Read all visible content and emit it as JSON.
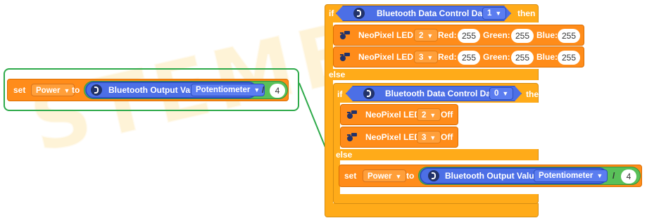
{
  "watermark": "STEMEL",
  "left_block": {
    "set_label": "set",
    "var_dd": "Power",
    "to_label": "to",
    "bt_label": "Bluetooth Output Value",
    "bt_dd": "Potentiometer",
    "div_op": "/",
    "divisor": "4"
  },
  "if1": {
    "if_label": "if",
    "cond_label": "Bluetooth Data Control Data",
    "cond_dd": "1",
    "then_label": "then",
    "rows": [
      {
        "label": "NeoPixel LED",
        "led_dd": "2",
        "red_label": "Red:",
        "red": "255",
        "green_label": "Green:",
        "green": "255",
        "blue_label": "Blue:",
        "blue": "255"
      },
      {
        "label": "NeoPixel LED",
        "led_dd": "3",
        "red_label": "Red:",
        "red": "255",
        "green_label": "Green:",
        "green": "255",
        "blue_label": "Blue:",
        "blue": "255"
      }
    ],
    "else_label": "else"
  },
  "if2": {
    "if_label": "if",
    "cond_label": "Bluetooth Data Control Data",
    "cond_dd": "0",
    "then_label": "then",
    "rows": [
      {
        "label": "NeoPixel LED",
        "led_dd": "2",
        "state": "Off"
      },
      {
        "label": "NeoPixel LED",
        "led_dd": "3",
        "state": "Off"
      }
    ],
    "else_label": "else"
  },
  "right_set": {
    "set_label": "set",
    "var_dd": "Power",
    "to_label": "to",
    "bt_label": "Bluetooth Output Value",
    "bt_dd": "Potentiometer",
    "div_op": "/",
    "divisor": "4"
  },
  "colors": {
    "control": "#ffab19",
    "action": "#ff8c1a",
    "bluetooth": "#4c6fe6",
    "operator": "#59c059",
    "highlight": "#2eaa4a"
  }
}
